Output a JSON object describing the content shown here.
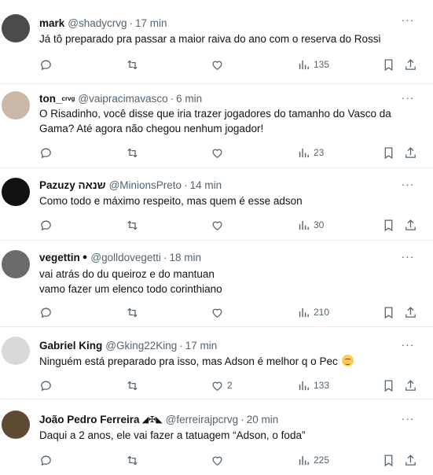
{
  "tweets": [
    {
      "name": "mark",
      "handle": "@shadycrvg",
      "time": "17 min",
      "text_lines": [
        "Já tô preparado pra passar a maior raiva do ano com o reserva do Rossi"
      ],
      "replies": "",
      "retweets": "",
      "likes": "",
      "views": "135",
      "avatar_color": "#4a4a4a"
    },
    {
      "name": "ton_",
      "name_suffix": "crvg",
      "handle": "@vaipracimavasco",
      "time": "6 min",
      "text_lines": [
        "O Risadinho, você disse que iria trazer jogadores do tamanho do Vasco da",
        "Gama? Até agora não chegou nenhum jogador!"
      ],
      "replies": "",
      "retweets": "",
      "likes": "",
      "views": "23",
      "avatar_color": "#c9b8a6"
    },
    {
      "name": "Pazuzy שנאה",
      "handle": "@MinionsPreto",
      "time": "14 min",
      "text_lines": [
        "Como todo e máximo respeito, mas quem é esse adson"
      ],
      "replies": "",
      "retweets": "",
      "likes": "",
      "views": "30",
      "avatar_color": "#111111"
    },
    {
      "name": "vegettin",
      "handle": "@golldovegetti",
      "time": "18 min",
      "text_lines": [
        "vai atrás do du queiroz e do mantuan",
        "vamo fazer um elenco todo corinthiano"
      ],
      "replies": "",
      "retweets": "",
      "likes": "",
      "views": "210",
      "avatar_color": "#6b6b6b"
    },
    {
      "name": "Gabriel King",
      "handle": "@Gking22King",
      "time": "17 min",
      "text_lines": [
        "Ninguém está preparado pra isso, mas Adson é melhor q o Pec"
      ],
      "replies": "",
      "retweets": "",
      "likes": "2",
      "views": "133",
      "avatar_color": "#d9d9d9"
    },
    {
      "name": "João Pedro Ferreira",
      "handle": "@ferreirajpcrvg",
      "time": "20 min",
      "text_lines": [
        "Daqui a 2 anos, ele vai fazer a tatuagem “Adson, o foda”"
      ],
      "replies": "",
      "retweets": "",
      "likes": "",
      "views": "225",
      "avatar_color": "#5e4a32"
    }
  ],
  "ui": {
    "more_glyph": "···",
    "separator": "·"
  },
  "icons": [
    "reply-icon",
    "retweet-icon",
    "like-icon",
    "views-icon",
    "bookmark-icon",
    "share-icon",
    "more-icon"
  ],
  "colors": {
    "text": "#0f1419",
    "secondary": "#536471",
    "divider": "#e6ecf0"
  }
}
